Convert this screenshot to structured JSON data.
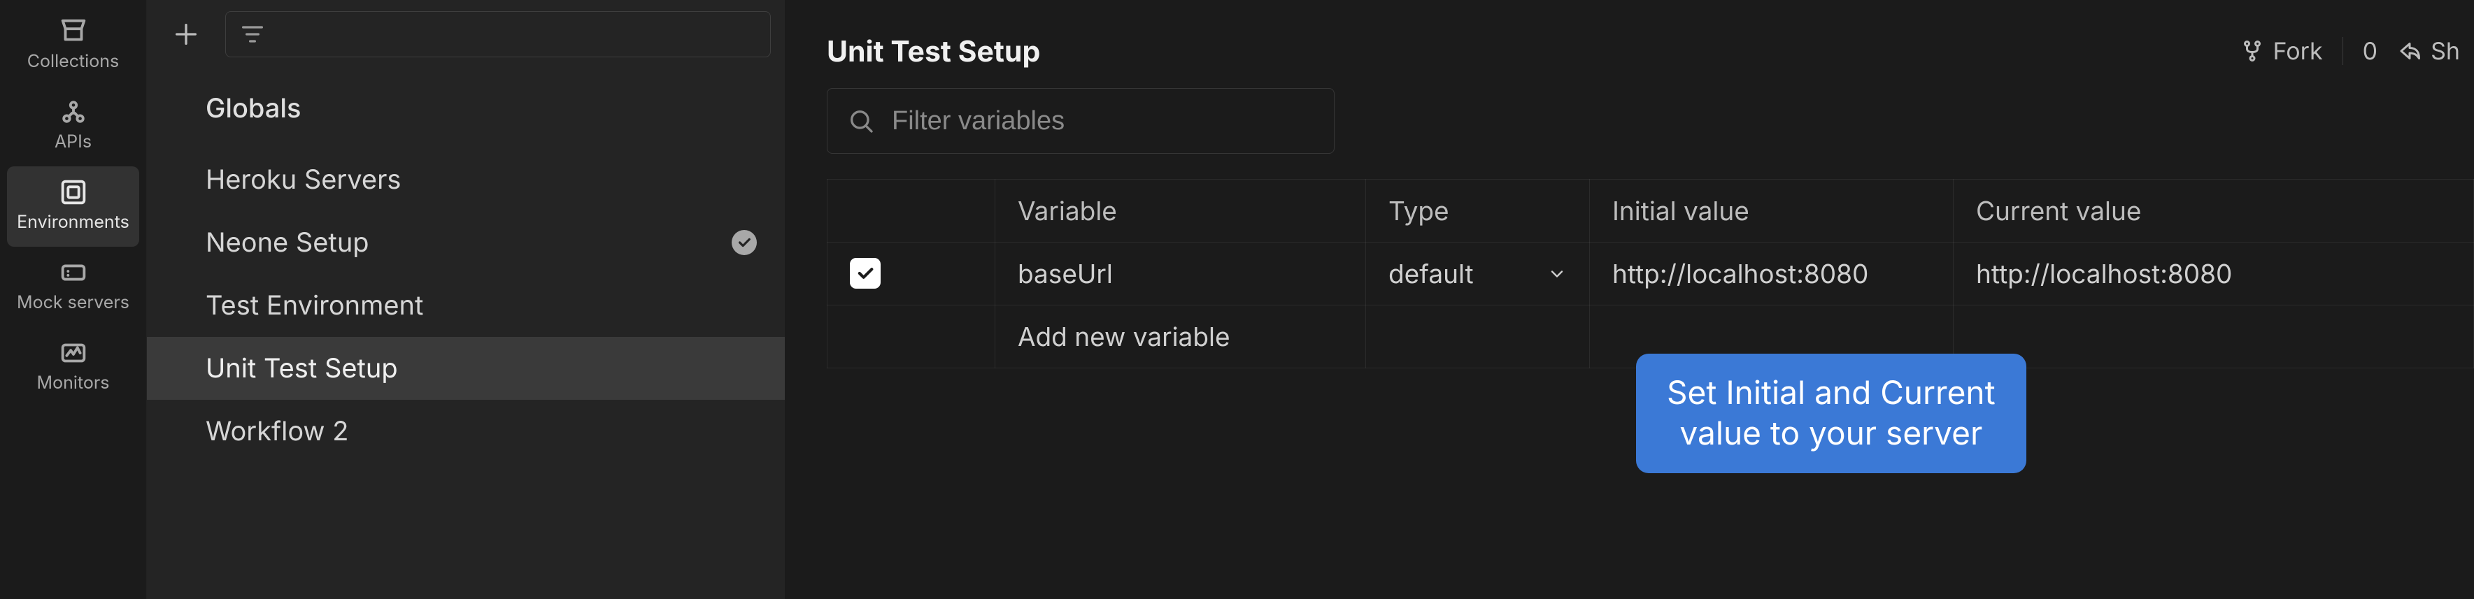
{
  "rail": {
    "items": [
      {
        "label": "Collections"
      },
      {
        "label": "APIs"
      },
      {
        "label": "Environments"
      },
      {
        "label": "Mock servers"
      },
      {
        "label": "Monitors"
      }
    ]
  },
  "sidebar": {
    "globals_label": "Globals",
    "environments": [
      {
        "name": "Heroku Servers",
        "active_checked": false
      },
      {
        "name": "Neone Setup",
        "active_checked": true
      },
      {
        "name": "Test Environment",
        "active_checked": false
      },
      {
        "name": "Unit Test Setup",
        "active_checked": false
      },
      {
        "name": "Workflow 2",
        "active_checked": false
      }
    ],
    "selected_index": 3
  },
  "main": {
    "title": "Unit Test Setup",
    "filter_placeholder": "Filter variables",
    "actions": {
      "fork_label": "Fork",
      "fork_count": "0",
      "share_label": "Sh"
    },
    "columns": {
      "variable": "Variable",
      "type": "Type",
      "initial": "Initial value",
      "current": "Current value"
    },
    "rows": [
      {
        "enabled": true,
        "variable": "baseUrl",
        "type": "default",
        "initial": "http://localhost:8080",
        "current": "http://localhost:8080"
      }
    ],
    "add_row_placeholder": "Add new variable",
    "callout_line1": "Set Initial and Current",
    "callout_line2": "value to your server"
  }
}
